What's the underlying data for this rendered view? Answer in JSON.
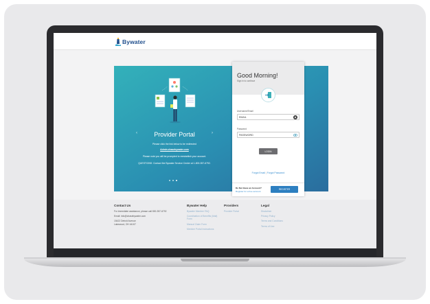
{
  "brand": {
    "name": "Bywater",
    "color": "#1f4e8c"
  },
  "hero": {
    "title": "Provider Portal",
    "line1": "Please click the link below to be redirected",
    "link": "Admin.chasebywater.com",
    "line2": "Please note you will be prompted to reestablish your account.",
    "line3": "QUESTIONS: Contact the Bywater Service Center at 1-800-357-6792.",
    "prev_arrow": "‹",
    "next_arrow": "›",
    "slide_count": 3,
    "active_slide": 3
  },
  "login": {
    "greeting": "Good Morning!",
    "subtitle": "Sign in to continue",
    "username_label": "Username/Email",
    "username_placeholder": "EMAIL",
    "password_label": "Password",
    "password_placeholder": "PASSWORD",
    "login_button": "LOGIN",
    "forgot_email": "Forgot Email",
    "separator": "|",
    "forgot_password": "Forgot Password",
    "register_question": "Do Not Have an Account?",
    "register_link": "Register for a free account",
    "register_button": "REGISTER"
  },
  "footer": {
    "contact": {
      "heading": "Contact Us",
      "assist": "For immediate assistance, please call 800-357-6792",
      "email": "Email: info@chasebywater.com",
      "address1": "15422 Detroit Avenue",
      "address2": "Lakewood, OH 44107"
    },
    "help": {
      "heading": "Bywater Help",
      "items": [
        "Bywater Member FAQ",
        "Coordination of Benefits (Mail) Form",
        "Manual Claim Form",
        "Member Portal Instructions"
      ]
    },
    "providers": {
      "heading": "Providers",
      "items": [
        "Provider Portal"
      ]
    },
    "legal": {
      "heading": "Legal",
      "items": [
        "Disclaimer",
        "Privacy Policy",
        "Terms and Conditions",
        "Terms of Use"
      ]
    }
  },
  "colors": {
    "hero_start": "#33b1ba",
    "hero_end": "#2a6d9e",
    "button_dark": "#6d6d70",
    "button_blue": "#2d7fc0"
  }
}
